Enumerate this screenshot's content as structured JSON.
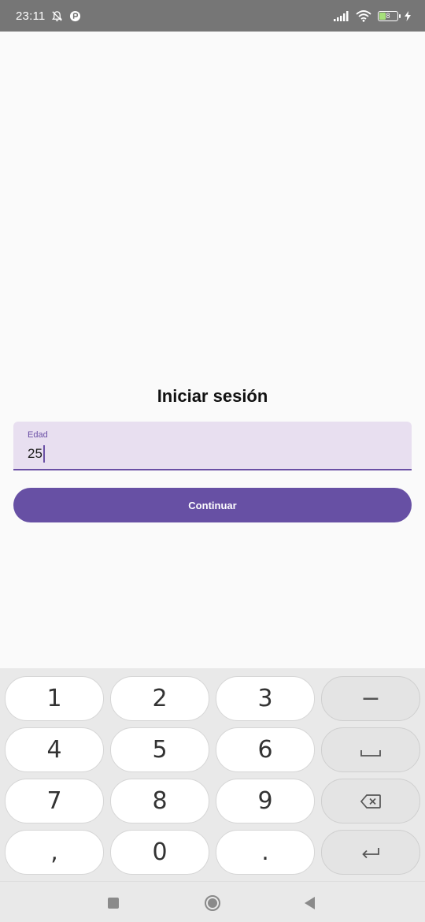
{
  "status_bar": {
    "time": "23:11",
    "battery_level": "8",
    "icons": [
      "alarm-off-icon",
      "app-notification-icon",
      "signal-icon",
      "wifi-icon",
      "battery-icon",
      "charging-icon"
    ]
  },
  "login": {
    "title": "Iniciar sesión",
    "age_field": {
      "label": "Edad",
      "value": "25"
    },
    "continue_label": "Continuar"
  },
  "keyboard": {
    "rows": [
      [
        "1",
        "2",
        "3",
        "−"
      ],
      [
        "4",
        "5",
        "6",
        "space"
      ],
      [
        "7",
        "8",
        "9",
        "backspace"
      ],
      [
        ",",
        "0",
        ".",
        "enter"
      ]
    ]
  },
  "nav_bar": {
    "icons": [
      "recents-icon",
      "home-icon",
      "back-icon"
    ]
  },
  "colors": {
    "status_bar_bg": "#767676",
    "accent": "#6750a4",
    "field_bg": "#e8dff0",
    "background": "#fafafa",
    "keyboard_bg": "#e9e9e9"
  }
}
